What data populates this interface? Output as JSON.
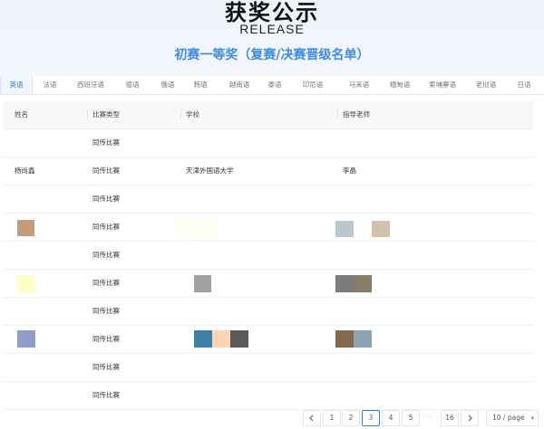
{
  "hero": {
    "title": "获奖公示",
    "subtitle": "RELEASE",
    "heading": "初赛一等奖（复赛/决赛晋级名单）"
  },
  "tabs": [
    {
      "label": "英语",
      "active": true
    },
    {
      "label": "法语"
    },
    {
      "label": "西班牙语"
    },
    {
      "label": "德语"
    },
    {
      "label": "俄语"
    },
    {
      "label": "韩语"
    },
    {
      "label": "越南语"
    },
    {
      "label": "泰语"
    },
    {
      "label": "印尼语"
    },
    {
      "label": "马来语"
    },
    {
      "label": "缅甸语"
    },
    {
      "label": "柬埔寨语"
    },
    {
      "label": "老挝语"
    },
    {
      "label": "日语"
    }
  ],
  "table": {
    "columns": [
      "姓名",
      "比赛类型",
      "学校",
      "指导老师"
    ],
    "rows": [
      {
        "name": "",
        "type": "同传比赛",
        "school": "",
        "teacher": ""
      },
      {
        "name": "杨尚鑫",
        "type": "同传比赛",
        "school": "天津外国语大学",
        "teacher": "李晶"
      },
      {
        "name": "",
        "type": "同传比赛",
        "school": "",
        "teacher": ""
      },
      {
        "name": "",
        "type": "同传比赛",
        "school": "",
        "teacher": ""
      },
      {
        "name": "",
        "type": "同传比赛",
        "school": "",
        "teacher": ""
      },
      {
        "name": "",
        "type": "同传比赛",
        "school": "",
        "teacher": ""
      },
      {
        "name": "",
        "type": "同传比赛",
        "school": "",
        "teacher": ""
      },
      {
        "name": "",
        "type": "同传比赛",
        "school": "",
        "teacher": ""
      },
      {
        "name": "",
        "type": "同传比赛",
        "school": "",
        "teacher": ""
      },
      {
        "name": "",
        "type": "同传比赛",
        "school": "",
        "teacher": ""
      }
    ]
  },
  "redaction_colors": [
    "#c39b7d",
    "#b9c8cc",
    "#d2c2ad",
    "#ffffc8",
    "#a1a1a1",
    "#7c7c7c",
    "#8a7a6a",
    "#8e9ec9",
    "#3e7fa5",
    "#fdd5b2",
    "#5a5a5a",
    "#816b4c",
    "#8aa4b2",
    "#fffef2"
  ],
  "pagination": {
    "prev_icon": "chevron-left-icon",
    "next_icon": "chevron-right-icon",
    "pages": [
      "1",
      "2",
      "3",
      "4",
      "5"
    ],
    "current": "3",
    "ellipsis": "···",
    "last": "16",
    "page_size": "10 / page"
  }
}
